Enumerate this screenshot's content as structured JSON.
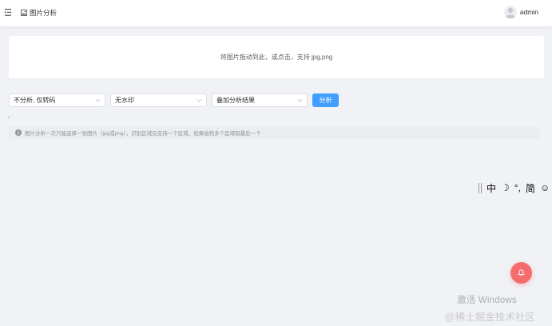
{
  "header": {
    "breadcrumb_label": "图片分析",
    "username": "admin"
  },
  "upload": {
    "hint": "将图片拖动到此，或点击，支持 jpg,png"
  },
  "controls": {
    "select_1": "不分析, 仅转码",
    "select_2": "无水印",
    "select_3": "叠加分析结果",
    "analyze_label": "分析"
  },
  "notice": {
    "text": "图片分析一次只能选择一张图片（jpg或png），识别区域仅支持一个区域，如果绘制多个区域取最后一个"
  },
  "ime_toolbar": {
    "items": [
      "中",
      "☽",
      "°,",
      "简",
      "☺"
    ]
  },
  "watermarks": {
    "activate": "激活 Windows",
    "juejin": "@稀土掘金技术社区"
  },
  "colors": {
    "primary": "#409eff",
    "fab": "#f56c6c",
    "background": "#f0f2f5"
  },
  "icons": {
    "menu": "hamburger-icon",
    "breadcrumb": "image-icon",
    "avatar": "user-avatar-icon",
    "select": "chevron-down-icon",
    "notice": "info-icon",
    "fab": "bell-icon"
  }
}
